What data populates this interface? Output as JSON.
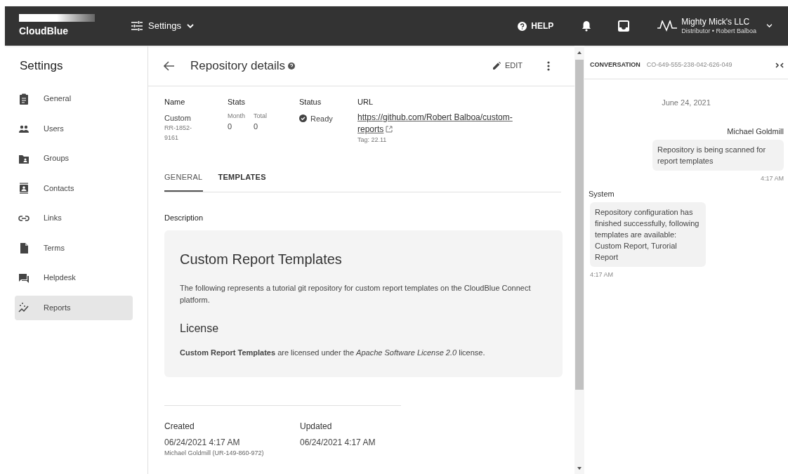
{
  "topbar": {
    "logo": "CloudBlue",
    "module": "Settings",
    "help": "HELP",
    "account": {
      "name": "Mighty Mick's LLC",
      "subtitle": "Distributor • Robert Balboa"
    }
  },
  "sidebar": {
    "title": "Settings",
    "items": [
      {
        "label": "General",
        "selected": false
      },
      {
        "label": "Users",
        "selected": false
      },
      {
        "label": "Groups",
        "selected": false
      },
      {
        "label": "Contacts",
        "selected": false
      },
      {
        "label": "Links",
        "selected": false
      },
      {
        "label": "Terms",
        "selected": false
      },
      {
        "label": "Helpdesk",
        "selected": false
      },
      {
        "label": "Reports",
        "selected": true
      }
    ]
  },
  "header": {
    "title": "Repository details",
    "edit": "EDIT"
  },
  "details": {
    "name_label": "Name",
    "name": "Custom",
    "id": "RR-1852-9161",
    "stats_label": "Stats",
    "month_label": "Month",
    "month": "0",
    "total_label": "Total",
    "total": "0",
    "status_label": "Status",
    "status": "Ready",
    "url_label": "URL",
    "url": "https://github.com/Robert Balboa/custom-reports",
    "tag": "Tag: 22.11"
  },
  "tabs": [
    {
      "label": "GENERAL",
      "selected": true
    },
    {
      "label": "TEMPLATES",
      "selected": false
    }
  ],
  "description": {
    "label": "Description",
    "heading": "Custom Report Templates",
    "text": "The following represents a tutorial git repository for custom report templates on the CloudBlue Connect platform.",
    "license_heading": "License",
    "license_text": "**Custom Report Templates** are licensed under the *Apache Software License 2.0* license."
  },
  "footer": {
    "created_label": "Created",
    "created": "06/24/2021 4:17 AM",
    "created_by": "Michael Goldmill (UR-149-860-972)",
    "updated_label": "Updated",
    "updated": "06/24/2021 4:17 AM"
  },
  "conversation": {
    "title": "CONVERSATION",
    "id": "CO-649-555-238-042-626-049",
    "date": "June 24, 2021",
    "messages": [
      {
        "sender": "Michael Goldmill",
        "text": "Repository is being scanned for report templates",
        "time": "4:17 AM",
        "kind": "outgoing"
      },
      {
        "sender": "System",
        "text": "Repository configuration has finished successfully, following templates are available: Custom Report, Turorial Report",
        "time": "4:17 AM",
        "kind": "incoming"
      }
    ]
  }
}
